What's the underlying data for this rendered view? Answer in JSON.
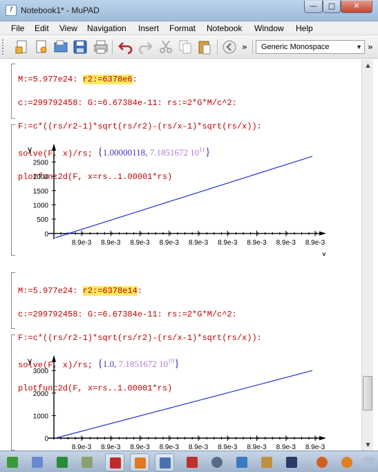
{
  "window": {
    "title": "Notebook1* - MuPAD",
    "min": "—",
    "max": "□",
    "close": "✕"
  },
  "menu": [
    "File",
    "Edit",
    "View",
    "Navigation",
    "Insert",
    "Format",
    "Notebook",
    "Window",
    "Help"
  ],
  "toolbar": {
    "font": "Generic Monospace",
    "buttons": [
      "new-notebook",
      "new-editor",
      "open",
      "save",
      "print",
      "undo",
      "redo",
      "cut",
      "copy",
      "paste",
      "evaluate"
    ]
  },
  "cells": [
    {
      "line1_a": "M:=5.977e24: ",
      "line1_hl": "r2:=6378e6",
      "line1_b": ":",
      "line2": "c:=299792458: G:=6.67384e-11: rs:=2*G*M/c^2:",
      "line3": "F:=c*((rs/r2-1)*sqrt(rs/r2)-(rs/x-1)*sqrt(rs/x)):",
      "line4": "solve(F, x)/rs; ",
      "result_open": "{",
      "result_first": "1.00000118",
      "result_sep": ", ",
      "result_second": "7.1851672 10",
      "result_exp": "11",
      "result_close": "}",
      "line5": "plotfunc2d(F, x=rs..1.00001*rs)"
    },
    {
      "line1_a": "M:=5.977e24: ",
      "line1_hl": "r2:=6378e14",
      "line1_b": ":",
      "line2": "c:=299792458: G:=6.67384e-11: rs:=2*G*M/c^2:",
      "line3": "F:=c*((rs/r2-1)*sqrt(rs/r2)-(rs/x-1)*sqrt(rs/x)):",
      "line4": "solve(F, x)/rs; ",
      "result_open": "{",
      "result_first": "1.0",
      "result_sep": ", ",
      "result_second": "7.1851672 10",
      "result_exp": "19",
      "result_close": "}",
      "line5": "plotfunc2d(F, x=rs..1.00001*rs)"
    }
  ],
  "chart_data": [
    {
      "type": "line",
      "xlabel": "x",
      "ylabel": "y",
      "x_tick_labels": [
        "8.9e-3",
        "8.9e-3",
        "8.9e-3",
        "8.9e-3",
        "8.9e-3",
        "8.9e-3",
        "8.9e-3",
        "8.9e-3",
        "8.9e-3"
      ],
      "y_ticks": [
        0,
        500,
        1000,
        1500,
        2000,
        2500
      ],
      "ylim": [
        -150,
        2800
      ],
      "series": [
        {
          "x": [
            0,
            1
          ],
          "y": [
            -150,
            2700
          ],
          "color": "#1f2fd0"
        }
      ],
      "grid": false
    },
    {
      "type": "line",
      "xlabel": "",
      "ylabel": "y",
      "x_tick_labels": [
        "8.9e-3",
        "8.9e-3",
        "8.9e-3",
        "8.9e-3",
        "8.9e-3",
        "8.9e-3",
        "8.9e-3",
        "8.9e-3",
        "8.9e-3"
      ],
      "y_ticks": [
        0,
        1000,
        2000,
        3000
      ],
      "ylim": [
        0,
        3250
      ],
      "series": [
        {
          "x": [
            0,
            1
          ],
          "y": [
            0,
            3000
          ],
          "color": "#1f2fd0"
        }
      ],
      "grid": false
    }
  ],
  "taskbar": [
    "start",
    "paint",
    "excel",
    "calculator",
    "app-red",
    "matlab",
    "mupad",
    "visio",
    "network",
    "photoshop",
    "pen",
    "winamp",
    "firefox",
    "app-orange"
  ]
}
